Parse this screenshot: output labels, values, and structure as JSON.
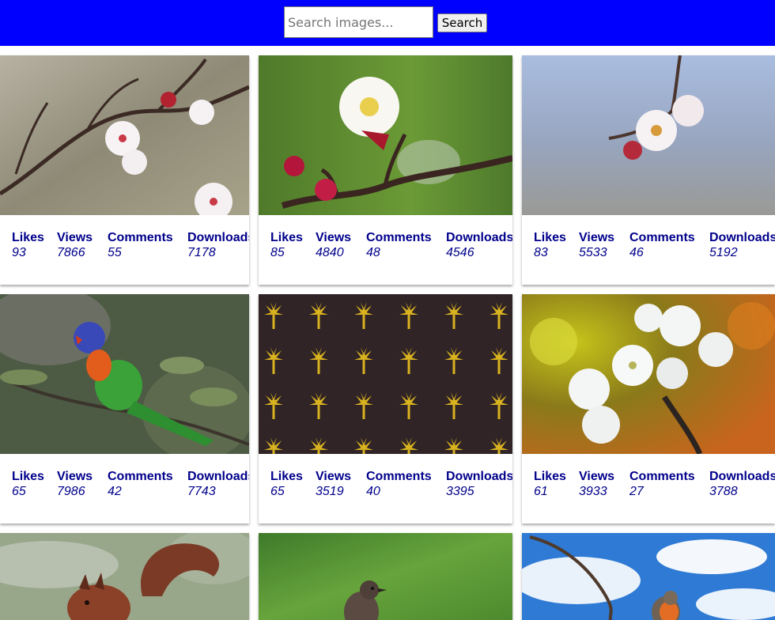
{
  "search": {
    "placeholder": "Search images...",
    "button_label": "Search"
  },
  "stat_labels": {
    "likes": "Likes",
    "views": "Views",
    "comments": "Comments",
    "downloads": "Downloads"
  },
  "cards": [
    {
      "image": "cherry-blossom-branch-photo",
      "likes": "93",
      "views": "7866",
      "comments": "55",
      "downloads": "7178"
    },
    {
      "image": "apricot-blossom-photo",
      "likes": "85",
      "views": "4840",
      "comments": "48",
      "downloads": "4546"
    },
    {
      "image": "blossom-twig-blue-sky-photo",
      "likes": "83",
      "views": "5533",
      "comments": "46",
      "downloads": "5192"
    },
    {
      "image": "rainbow-lorikeet-photo",
      "likes": "65",
      "views": "7986",
      "comments": "42",
      "downloads": "7743"
    },
    {
      "image": "golden-palm-pattern-image",
      "likes": "65",
      "views": "3519",
      "comments": "40",
      "downloads": "3395"
    },
    {
      "image": "white-cherry-flowers-photo",
      "likes": "61",
      "views": "3933",
      "comments": "27",
      "downloads": "3788"
    },
    {
      "image": "red-squirrel-photo"
    },
    {
      "image": "small-bird-green-background-photo"
    },
    {
      "image": "robin-blue-sky-photo"
    }
  ],
  "colors": {
    "header_bg": "#0000ff",
    "stat_text": "#00008b"
  }
}
